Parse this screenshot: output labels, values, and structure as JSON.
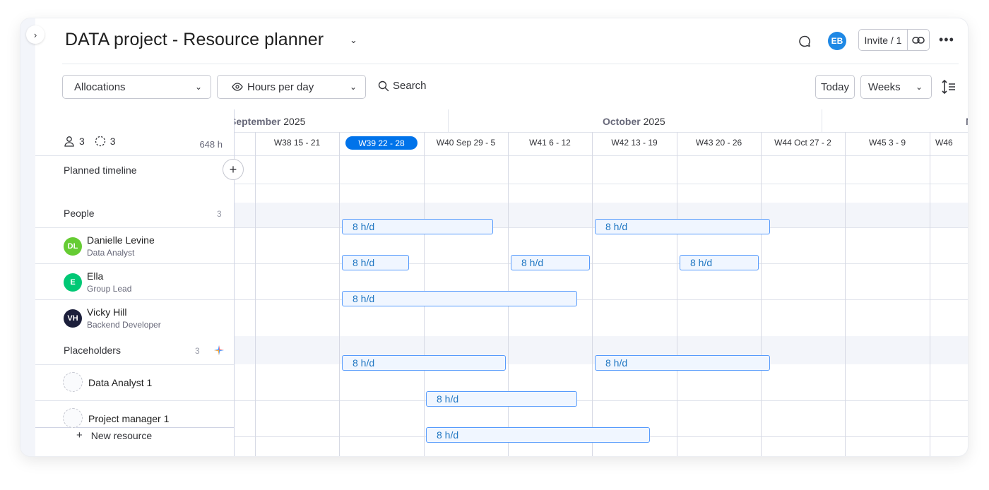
{
  "header": {
    "title": "DATA project - Resource planner",
    "avatar_initials": "EB",
    "invite_label": "Invite / 1"
  },
  "toolbar": {
    "allocations_label": "Allocations",
    "hours_label": "Hours per day",
    "search_label": "Search",
    "today_label": "Today",
    "weeks_label": "Weeks"
  },
  "summary": {
    "people_count": "3",
    "placeholder_count": "3",
    "total_hours": "648 h",
    "planned_timeline_label": "Planned timeline"
  },
  "timeline": {
    "months": [
      {
        "name": "September",
        "year": "2025"
      },
      {
        "name": "October",
        "year": "2025"
      },
      {
        "name": "N",
        "year": ""
      }
    ],
    "weeks": [
      {
        "label": "W38 15 - 21"
      },
      {
        "label": "W39 22 - 28",
        "current": true
      },
      {
        "label": "W40 Sep 29 - 5"
      },
      {
        "label": "W41 6 - 12"
      },
      {
        "label": "W42 13 - 19"
      },
      {
        "label": "W43 20 - 26"
      },
      {
        "label": "W44 Oct 27 - 2"
      },
      {
        "label": "W45 3 - 9"
      },
      {
        "label": "W46"
      }
    ]
  },
  "groups": {
    "people": {
      "label": "People",
      "count": "3"
    },
    "placeholders": {
      "label": "Placeholders",
      "count": "3"
    }
  },
  "people": [
    {
      "initials": "DL",
      "name": "Danielle Levine",
      "role": "Data Analyst",
      "color": "#66cc33",
      "bars": [
        {
          "label": "8 h/d"
        },
        {
          "label": "8 h/d"
        }
      ]
    },
    {
      "initials": "E",
      "name": "Ella",
      "role": "Group Lead",
      "color": "#00c875",
      "bars": [
        {
          "label": "8 h/d"
        },
        {
          "label": "8 h/d"
        },
        {
          "label": "8 h/d"
        }
      ]
    },
    {
      "initials": "VH",
      "name": "Vicky Hill",
      "role": "Backend Developer",
      "color": "#1c1f3b",
      "bars": [
        {
          "label": "8 h/d"
        }
      ]
    }
  ],
  "placeholders": [
    {
      "name": "Data Analyst 1",
      "bars": [
        {
          "label": "8 h/d"
        },
        {
          "label": "8 h/d"
        }
      ]
    },
    {
      "name": "Project manager 1",
      "bars": [
        {
          "label": "8 h/d"
        }
      ]
    },
    {
      "name": "",
      "bars": [
        {
          "label": "8 h/d"
        }
      ]
    }
  ],
  "footer": {
    "new_resource_label": "New resource"
  },
  "colors": {
    "accent": "#0073ea",
    "bar_border": "#579bfc",
    "bar_text": "#1f76c2",
    "group_bg": "#f3f5fa"
  }
}
